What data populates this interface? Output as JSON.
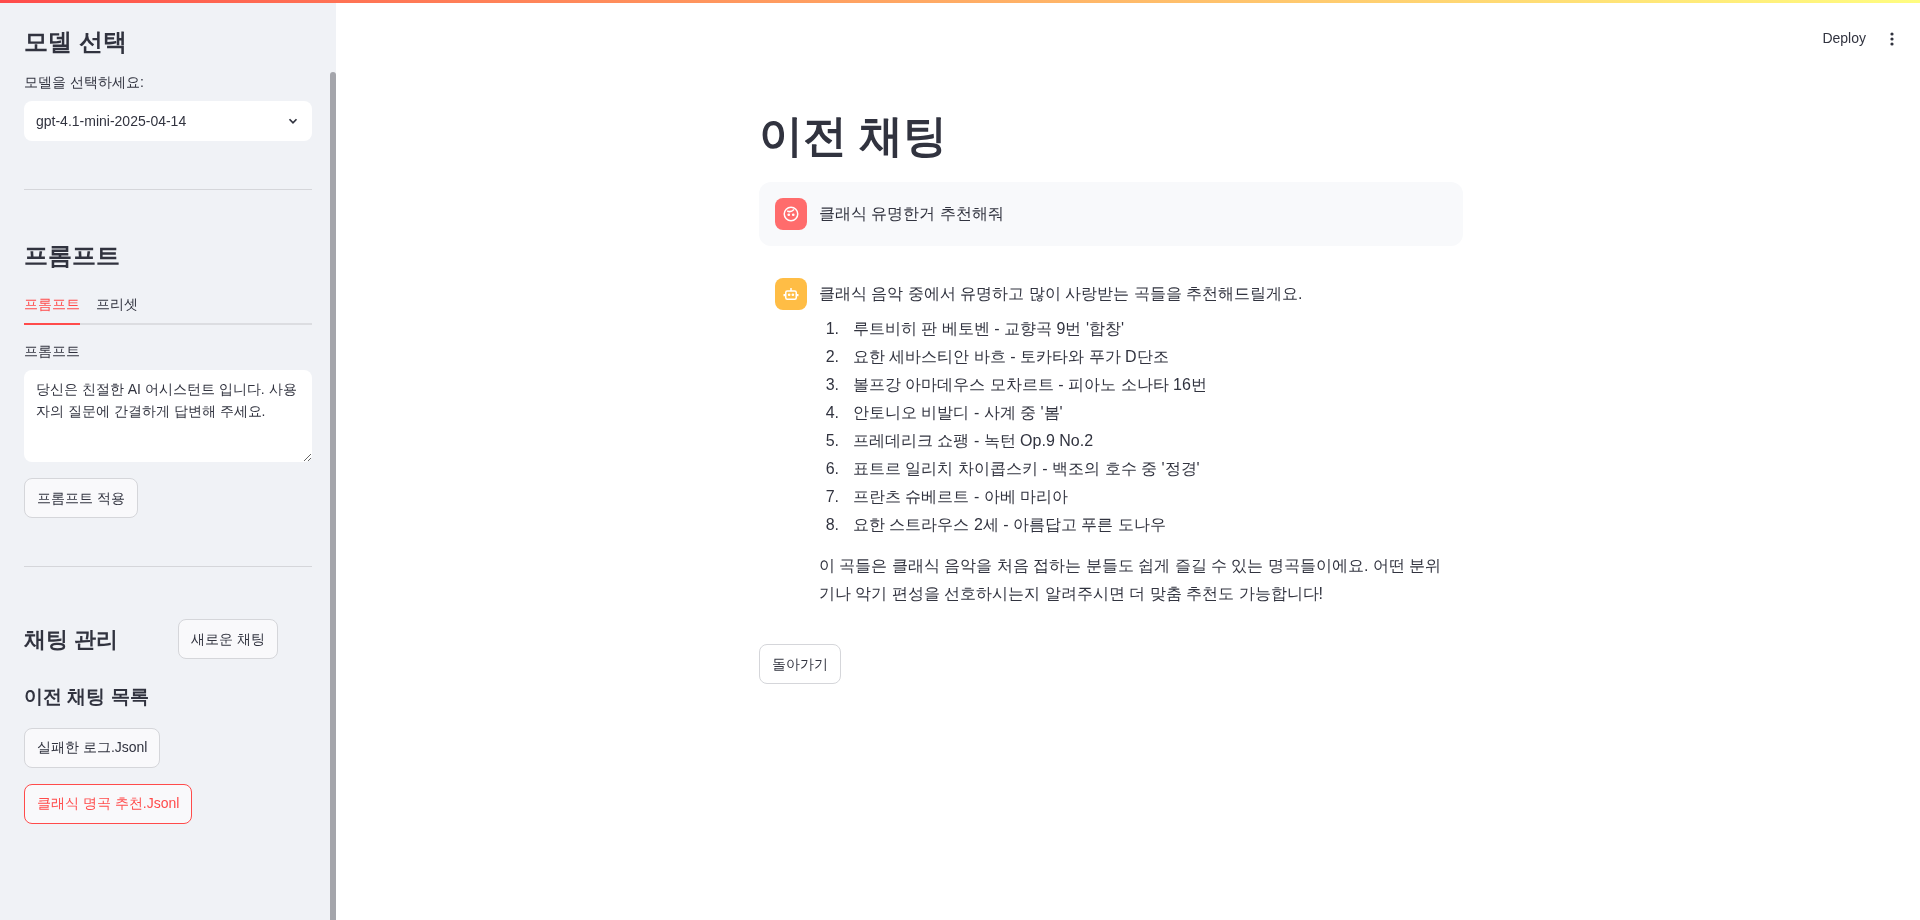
{
  "header": {
    "deploy": "Deploy"
  },
  "sidebar": {
    "model_section": {
      "title": "모델 선택",
      "label": "모델을 선택하세요:",
      "value": "gpt-4.1-mini-2025-04-14"
    },
    "prompt_section": {
      "title": "프롬프트",
      "tabs": [
        {
          "label": "프롬프트",
          "selected": true
        },
        {
          "label": "프리셋",
          "selected": false
        }
      ],
      "field_label": "프롬프트",
      "value": "당신은 친절한 AI 어시스턴트 입니다. 사용자의 질문에 간결하게 답변해 주세요.",
      "apply_button": "프롬프트 적용"
    },
    "chat_section": {
      "title": "채팅 관리",
      "new_button": "새로운 채팅",
      "list_title": "이전 채팅 목록",
      "chats": [
        {
          "label": "실패한 로그.Jsonl",
          "selected": false
        },
        {
          "label": "클래식 명곡 추천.Jsonl",
          "selected": true
        }
      ]
    }
  },
  "main": {
    "title": "이전 채팅",
    "messages": [
      {
        "kind": "user",
        "text": "클래식 유명한거 추천해줘"
      },
      {
        "kind": "assistant",
        "intro": "클래식 음악 중에서 유명하고 많이 사랑받는 곡들을 추천해드릴게요.",
        "items": [
          {
            "number": "1.",
            "text": "루트비히 판 베토벤 - 교향곡 9번 '합창'"
          },
          {
            "number": "2.",
            "text": "요한 세바스티안 바흐 - 토카타와 푸가 D단조"
          },
          {
            "number": "3.",
            "text": "볼프강 아마데우스 모차르트 - 피아노 소나타 16번"
          },
          {
            "number": "4.",
            "text": "안토니오 비발디 - 사계 중 '봄'"
          },
          {
            "number": "5.",
            "text": "프레데리크 쇼팽 - 녹턴 Op.9 No.2"
          },
          {
            "number": "6.",
            "text": "표트르 일리치 차이콥스키 - 백조의 호수 중 '정경'"
          },
          {
            "number": "7.",
            "text": "프란츠 슈베르트 - 아베 마리아"
          },
          {
            "number": "8.",
            "text": "요한 스트라우스 2세 - 아름답고 푸른 도나우"
          }
        ],
        "outro": "이 곡들은 클래식 음악을 처음 접하는 분들도 쉽게 즐길 수 있는 명곡들이에요. 어떤 분위기나 악기 편성을 선호하시는지 알려주시면 더 맞춤 추천도 가능합니다!"
      }
    ],
    "back_button": "돌아가기"
  }
}
